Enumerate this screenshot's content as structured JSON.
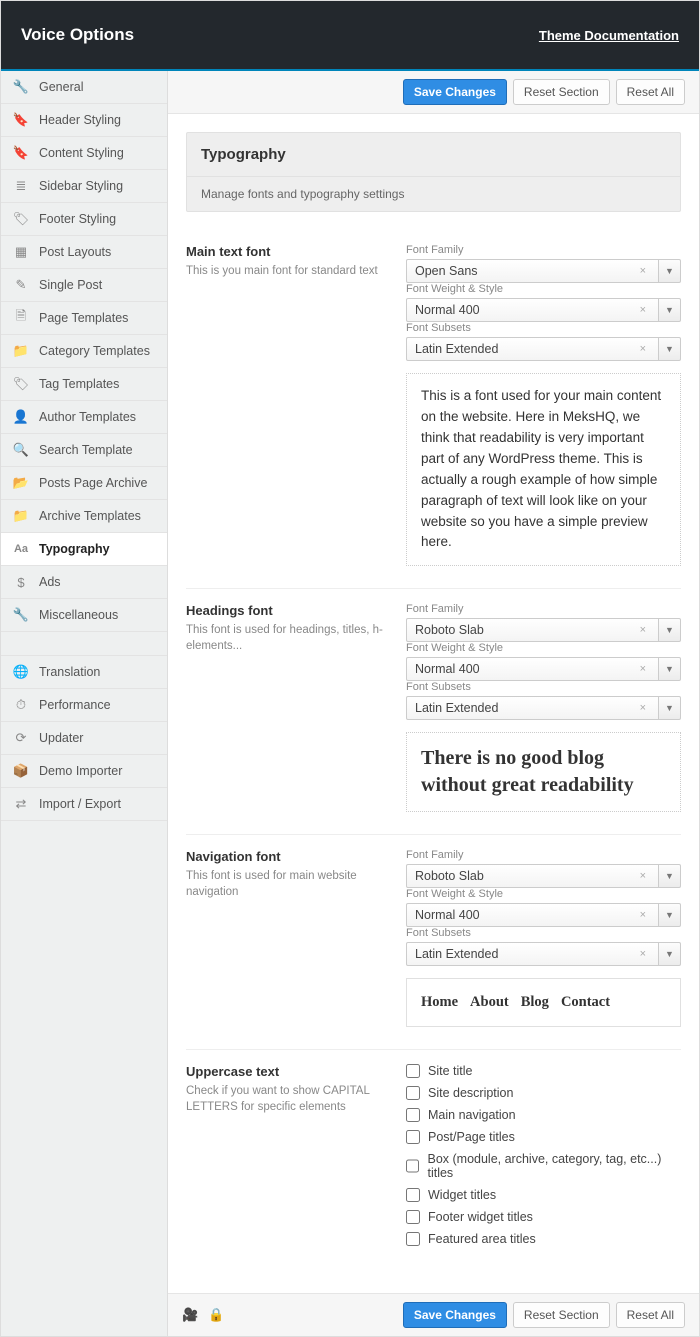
{
  "header": {
    "title": "Voice Options",
    "docLink": "Theme Documentation"
  },
  "actions": {
    "save": "Save Changes",
    "resetSection": "Reset Section",
    "resetAll": "Reset All"
  },
  "sidebar": {
    "items": [
      {
        "icon": "wrench",
        "label": "General"
      },
      {
        "icon": "bookmark",
        "label": "Header Styling"
      },
      {
        "icon": "bookmark",
        "label": "Content Styling"
      },
      {
        "icon": "list",
        "label": "Sidebar Styling"
      },
      {
        "icon": "bookmark-o",
        "label": "Footer Styling"
      },
      {
        "icon": "grid",
        "label": "Post Layouts"
      },
      {
        "icon": "pencil",
        "label": "Single Post"
      },
      {
        "icon": "file",
        "label": "Page Templates"
      },
      {
        "icon": "folder",
        "label": "Category Templates"
      },
      {
        "icon": "tag",
        "label": "Tag Templates"
      },
      {
        "icon": "user",
        "label": "Author Templates"
      },
      {
        "icon": "search",
        "label": "Search Template"
      },
      {
        "icon": "folder-open",
        "label": "Posts Page Archive"
      },
      {
        "icon": "folder",
        "label": "Archive Templates"
      },
      {
        "icon": "aa",
        "label": "Typography",
        "active": true
      },
      {
        "icon": "dollar",
        "label": "Ads"
      },
      {
        "icon": "wrench",
        "label": "Miscellaneous"
      }
    ],
    "items2": [
      {
        "icon": "globe",
        "label": "Translation"
      },
      {
        "icon": "gauge",
        "label": "Performance"
      },
      {
        "icon": "refresh",
        "label": "Updater"
      },
      {
        "icon": "box",
        "label": "Demo Importer"
      },
      {
        "icon": "swap",
        "label": "Import / Export"
      }
    ]
  },
  "panel": {
    "title": "Typography",
    "subtitle": "Manage fonts and typography settings"
  },
  "labels": {
    "fontFamily": "Font Family",
    "fontWeight": "Font Weight & Style",
    "fontSubsets": "Font Subsets"
  },
  "main": {
    "title": "Main text font",
    "desc": "This is you main font for standard text",
    "family": "Open Sans",
    "weight": "Normal 400",
    "subsets": "Latin Extended",
    "preview": "This is a font used for your main content on the website. Here in MeksHQ, we think that readability is very important part of any WordPress theme. This is actually a rough example of how simple paragraph of text will look like on your website so you have a simple preview here."
  },
  "headings": {
    "title": "Headings font",
    "desc": "This font is used for headings, titles, h-elements...",
    "family": "Roboto Slab",
    "weight": "Normal 400",
    "subsets": "Latin Extended",
    "preview": "There is no good blog without great readability"
  },
  "nav": {
    "title": "Navigation font",
    "desc": "This font is used for main website navigation",
    "family": "Roboto Slab",
    "weight": "Normal 400",
    "subsets": "Latin Extended",
    "previewItems": [
      "Home",
      "About",
      "Blog",
      "Contact"
    ]
  },
  "uppercase": {
    "title": "Uppercase text",
    "desc": "Check if you want to show CAPITAL LETTERS for specific elements",
    "options": [
      "Site title",
      "Site description",
      "Main navigation",
      "Post/Page titles",
      "Box (module, archive, category, tag, etc...) titles",
      "Widget titles",
      "Footer widget titles",
      "Featured area titles"
    ]
  },
  "icons": {
    "wrench": "🔧",
    "bookmark": "🔖",
    "bookmark-o": "🏷",
    "list": "≣",
    "grid": "▦",
    "pencil": "✎",
    "file": "🗎",
    "folder": "📁",
    "folder-open": "📂",
    "tag": "🏷",
    "user": "👤",
    "search": "🔍",
    "aa": "Aa",
    "dollar": "$",
    "globe": "🌐",
    "gauge": "⏱",
    "refresh": "⟳",
    "box": "📦",
    "swap": "⇄",
    "camera": "🎥",
    "lock": "🔒"
  }
}
